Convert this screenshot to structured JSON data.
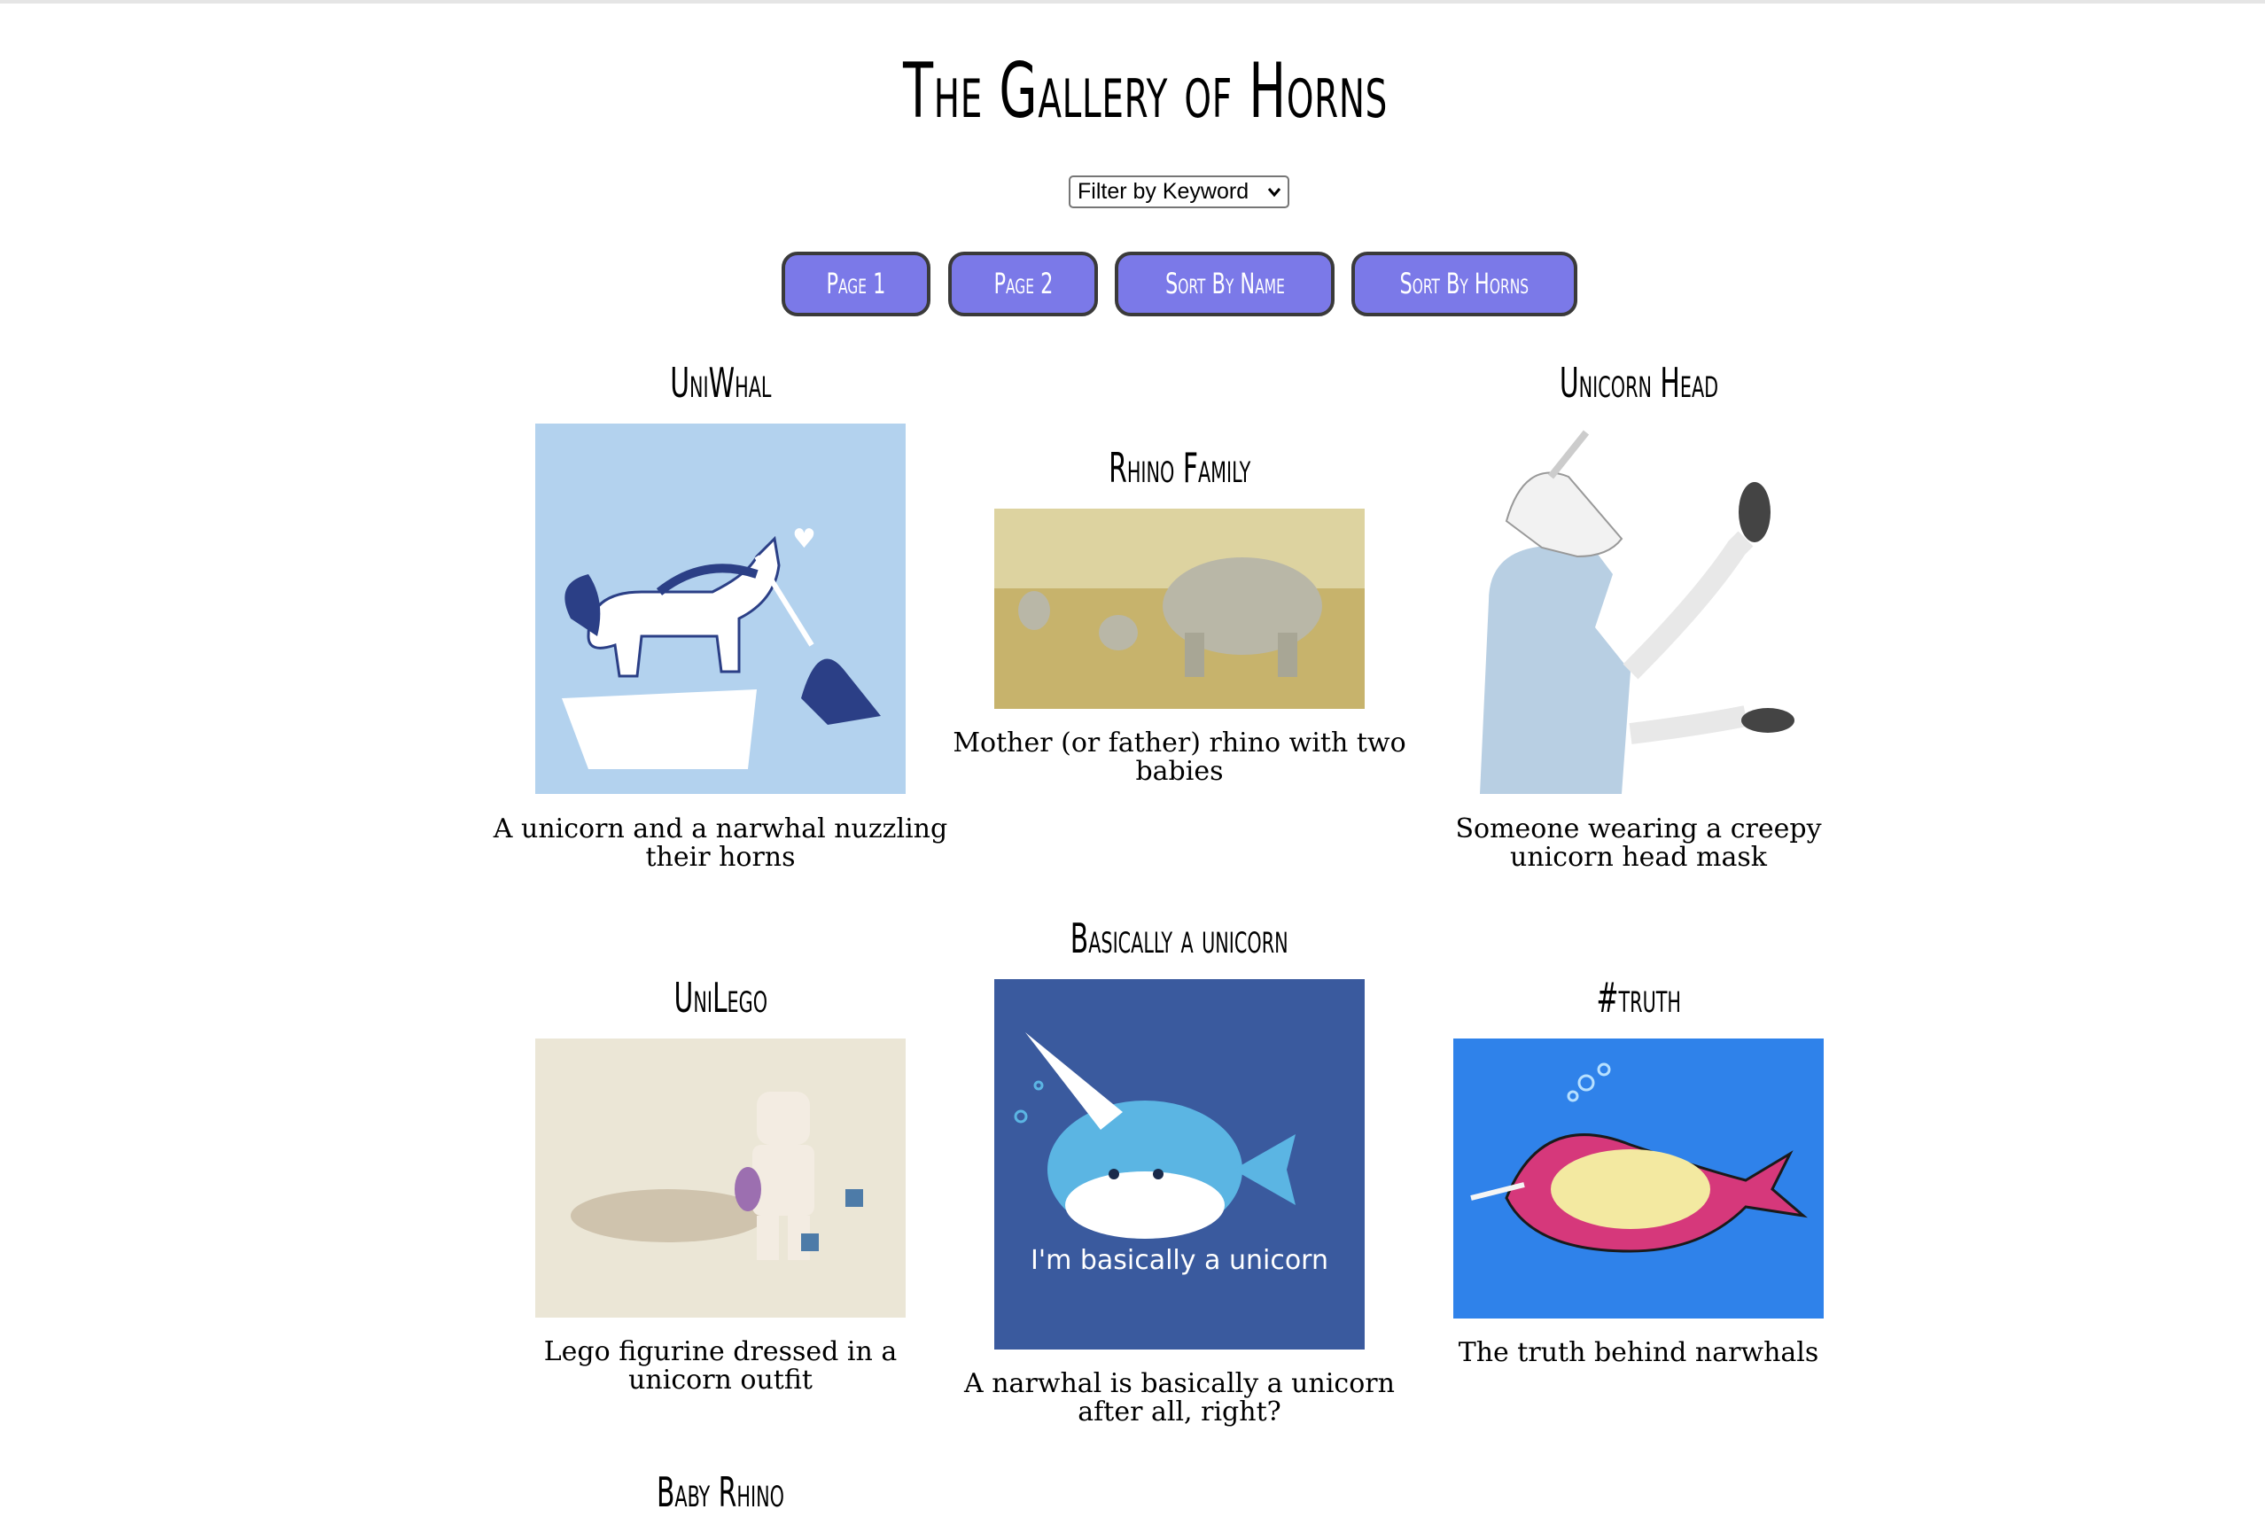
{
  "page": {
    "title": "The Gallery of Horns"
  },
  "filter": {
    "selected": "Filter by Keyword"
  },
  "nav": {
    "page1": "Page 1",
    "page2": "Page 2",
    "sort_name": "Sort By Name",
    "sort_horns": "Sort By Horns"
  },
  "cards": [
    {
      "title": "UniWhal",
      "description": "A unicorn and a narwhal nuzzling their horns"
    },
    {
      "title": "Rhino Family",
      "description": "Mother (or father) rhino with two babies"
    },
    {
      "title": "Unicorn Head",
      "description": "Someone wearing a creepy unicorn head mask"
    },
    {
      "title": "UniLego",
      "description": "Lego figurine dressed in a unicorn outfit"
    },
    {
      "title": "Basically a unicorn",
      "description": "A narwhal is basically a unicorn after all, right?",
      "image_text": "I'm basically a unicorn"
    },
    {
      "title": "#truth",
      "description": "The truth behind narwhals"
    },
    {
      "title": "Baby Rhino"
    }
  ],
  "colors": {
    "button_bg": "#7b79e8",
    "button_border": "#3a3a3a"
  }
}
